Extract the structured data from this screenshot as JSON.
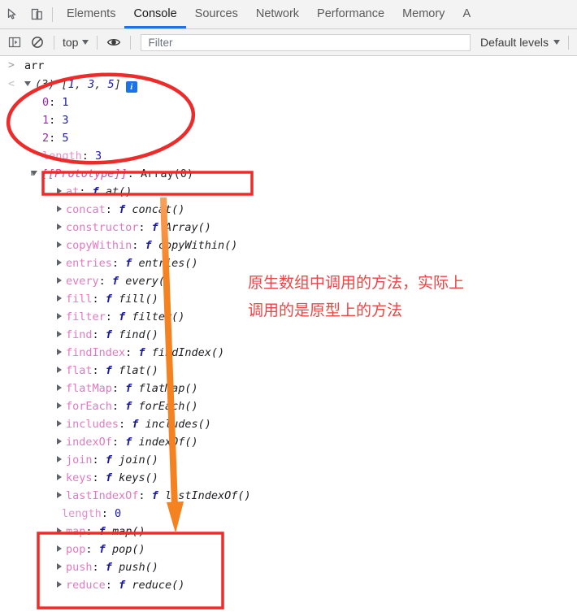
{
  "window": {
    "title": "Chrome DevTools Console"
  },
  "tabbar": {
    "inspect_icon": "inspect-cursor-icon",
    "device_icon": "device-toolbar-icon",
    "tabs": [
      {
        "label": "Elements",
        "active": false
      },
      {
        "label": "Console",
        "active": true
      },
      {
        "label": "Sources",
        "active": false
      },
      {
        "label": "Network",
        "active": false
      },
      {
        "label": "Performance",
        "active": false
      },
      {
        "label": "Memory",
        "active": false
      },
      {
        "label": "A",
        "active": false
      }
    ]
  },
  "toolbar": {
    "sidebar_icon": "console-sidebar-icon",
    "clear_icon": "clear-console-icon",
    "context": "top",
    "eye_icon": "live-expression-icon",
    "filter_placeholder": "Filter",
    "filter_value": "",
    "levels_label": "Default levels"
  },
  "console": {
    "input": "arr",
    "result": {
      "count": "(3)",
      "preview_open": "[",
      "preview_items": [
        "1",
        "3",
        "5"
      ],
      "preview_close": "]",
      "info_icon": "info-icon"
    },
    "entries": [
      {
        "key": "0",
        "sep": ":",
        "value": "1",
        "kind": "index"
      },
      {
        "key": "1",
        "sep": ":",
        "value": "3",
        "kind": "index"
      },
      {
        "key": "2",
        "sep": ":",
        "value": "5",
        "kind": "index"
      },
      {
        "key": "length",
        "sep": ":",
        "value": "3",
        "kind": "length"
      }
    ],
    "prototype": {
      "key": "[[Prototype]]",
      "sep": ":",
      "value": "Array(0)"
    },
    "methods": [
      {
        "name": "at",
        "sig": "at()"
      },
      {
        "name": "concat",
        "sig": "concat()"
      },
      {
        "name": "constructor",
        "sig": "Array()"
      },
      {
        "name": "copyWithin",
        "sig": "copyWithin()"
      },
      {
        "name": "entries",
        "sig": "entries()"
      },
      {
        "name": "every",
        "sig": "every()"
      },
      {
        "name": "fill",
        "sig": "fill()"
      },
      {
        "name": "filter",
        "sig": "filter()"
      },
      {
        "name": "find",
        "sig": "find()"
      },
      {
        "name": "findIndex",
        "sig": "findIndex()"
      },
      {
        "name": "flat",
        "sig": "flat()"
      },
      {
        "name": "flatMap",
        "sig": "flatMap()"
      },
      {
        "name": "forEach",
        "sig": "forEach()"
      },
      {
        "name": "includes",
        "sig": "includes()"
      },
      {
        "name": "indexOf",
        "sig": "indexOf()"
      },
      {
        "name": "join",
        "sig": "join()"
      },
      {
        "name": "keys",
        "sig": "keys()"
      },
      {
        "name": "lastIndexOf",
        "sig": "lastIndexOf()"
      }
    ],
    "proto_length": {
      "key": "length",
      "sep": ":",
      "value": "0"
    },
    "methods_boxed": [
      {
        "name": "map",
        "sig": "map()"
      },
      {
        "name": "pop",
        "sig": "pop()"
      },
      {
        "name": "push",
        "sig": "push()"
      },
      {
        "name": "reduce",
        "sig": "reduce()"
      }
    ],
    "fn_mark": "f"
  },
  "annotations": {
    "note_line1": "原生数组中调用的方法，实际上",
    "note_line2": "调用的是原型上的方法",
    "ellipse_name": "red-ellipse-highlight",
    "box_prototype_name": "red-box-prototype",
    "box_methods_name": "red-box-methods",
    "arrow_name": "orange-arrow"
  },
  "colors": {
    "accent_blue": "#1a73e8",
    "annotation_red": "#ef4444",
    "annotation_orange": "#f58220",
    "prop_purple": "#9c27b0",
    "value_blue": "#1a1aa6",
    "method_pink": "#e07ac0"
  }
}
